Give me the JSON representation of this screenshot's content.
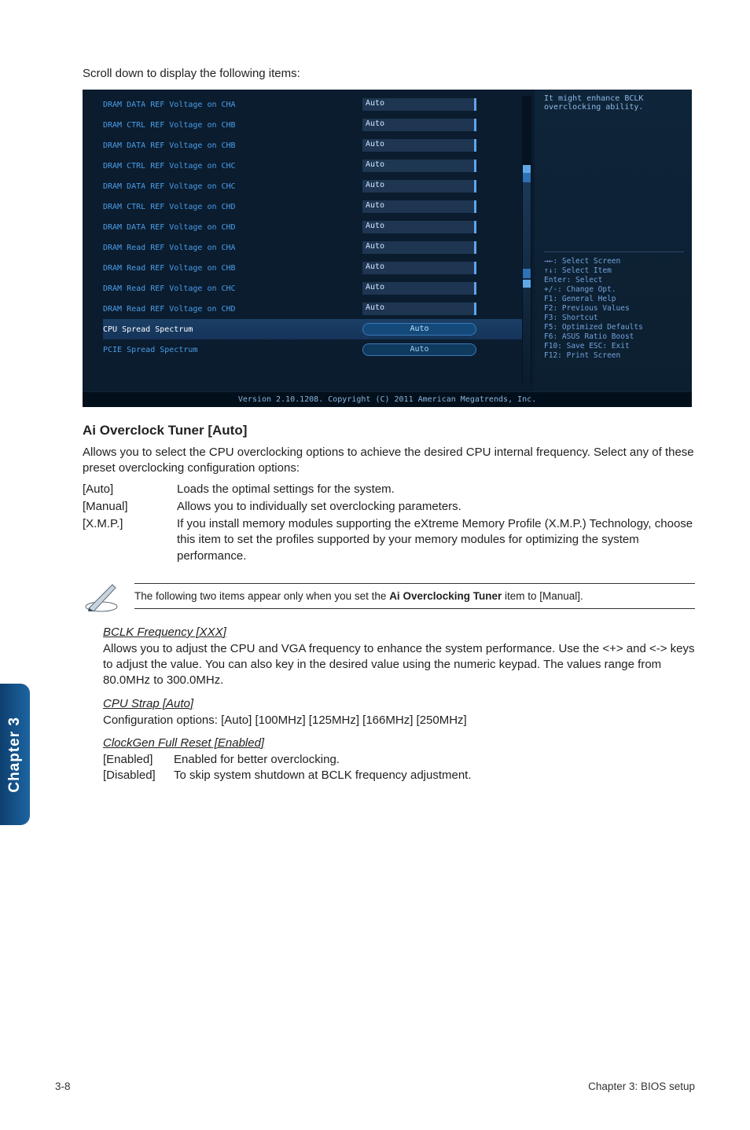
{
  "intro": "Scroll down to display the following items:",
  "bios": {
    "help_text": "It might enhance BCLK overclocking ability.",
    "rows": [
      {
        "label": "DRAM DATA REF Voltage on CHA",
        "value": "Auto"
      },
      {
        "label": "DRAM CTRL REF Voltage on CHB",
        "value": "Auto"
      },
      {
        "label": "DRAM DATA REF Voltage on CHB",
        "value": "Auto"
      },
      {
        "label": "DRAM CTRL REF Voltage on CHC",
        "value": "Auto"
      },
      {
        "label": "DRAM DATA REF Voltage on CHC",
        "value": "Auto"
      },
      {
        "label": "DRAM CTRL REF Voltage on CHD",
        "value": "Auto"
      },
      {
        "label": "DRAM DATA REF Voltage on CHD",
        "value": "Auto"
      },
      {
        "label": "DRAM Read REF Voltage on CHA",
        "value": "Auto"
      },
      {
        "label": "DRAM Read REF Voltage on CHB",
        "value": "Auto"
      },
      {
        "label": "DRAM Read REF Voltage on CHC",
        "value": "Auto"
      },
      {
        "label": "DRAM Read REF Voltage on CHD",
        "value": "Auto"
      },
      {
        "label": "CPU Spread Spectrum",
        "value": "Auto",
        "highlight": true
      },
      {
        "label": "PCIE Spread Spectrum",
        "value": "Auto",
        "button": true
      }
    ],
    "help_keys": [
      "→←: Select Screen",
      "↑↓: Select Item",
      "Enter: Select",
      "+/-: Change Opt.",
      "F1: General Help",
      "F2: Previous Values",
      "F3: Shortcut",
      "F5: Optimized Defaults",
      "F6: ASUS Ratio Boost",
      "F10: Save  ESC: Exit",
      "F12: Print Screen"
    ],
    "version": "Version 2.10.1208. Copyright (C) 2011 American Megatrends, Inc."
  },
  "section_title": "Ai Overclock Tuner [Auto]",
  "section_body": "Allows you to select the CPU overclocking options to achieve the desired CPU internal frequency. Select any of these preset overclocking configuration options:",
  "options": [
    {
      "k": "[Auto]",
      "v": "Loads the optimal settings for the system."
    },
    {
      "k": "[Manual]",
      "v": "Allows you to individually set overclocking parameters."
    },
    {
      "k": "[X.M.P.]",
      "v": "If you install memory modules supporting the eXtreme Memory Profile (X.M.P.) Technology, choose this item to set the profiles supported by your memory modules for optimizing the system performance."
    }
  ],
  "note_prefix": "The following two items appear only when you set the ",
  "note_bold": "Ai Overclocking Tuner",
  "note_suffix": " item to [Manual].",
  "bclk": {
    "title": "BCLK Frequency [XXX]",
    "body": "Allows you to adjust the CPU and VGA frequency to enhance the system performance. Use the <+> and <-> keys to adjust the value. You can also key in the desired value using the numeric keypad. The values range from 80.0MHz to 300.0MHz."
  },
  "cpu_strap": {
    "title": "CPU Strap [Auto]",
    "body": "Configuration options: [Auto] [100MHz] [125MHz] [166MHz] [250MHz]"
  },
  "clockgen": {
    "title": "ClockGen Full Reset [Enabled]",
    "options": [
      {
        "k": "[Enabled]",
        "v": "Enabled for better overclocking."
      },
      {
        "k": "[Disabled]",
        "v": "To skip system shutdown at BCLK frequency adjustment."
      }
    ]
  },
  "side_tab": "Chapter 3",
  "footer": {
    "left": "3-8",
    "right": "Chapter 3: BIOS setup"
  }
}
